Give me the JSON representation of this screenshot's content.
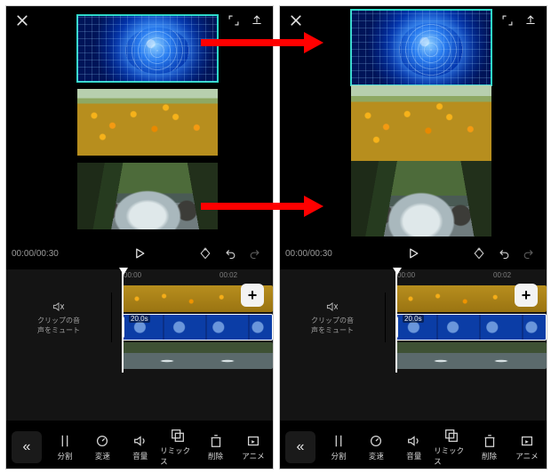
{
  "timecode": {
    "current": "00:00",
    "total": "00:30"
  },
  "ruler": {
    "t0": "00:00",
    "t1": "00:02"
  },
  "mute": {
    "line1": "クリップの音",
    "line2": "声をミュート"
  },
  "clip": {
    "selected_duration": "20.0s"
  },
  "add_label": "+",
  "toolbar": {
    "collapse": "«",
    "items": [
      {
        "id": "split",
        "label": "分割"
      },
      {
        "id": "speed",
        "label": "変速"
      },
      {
        "id": "volume",
        "label": "音量"
      },
      {
        "id": "remix",
        "label": "リミックス"
      },
      {
        "id": "delete",
        "label": "削除"
      },
      {
        "id": "anim",
        "label": "アニメ"
      }
    ]
  },
  "media": {
    "clips": [
      {
        "id": "globe",
        "desc": "blue digital globe"
      },
      {
        "id": "flowers",
        "desc": "orange flower field"
      },
      {
        "id": "creek",
        "desc": "forest creek"
      }
    ]
  },
  "layout": {
    "panelA": {
      "mediaTop": 10,
      "thumbH": 75,
      "gap": 8,
      "selected": true
    },
    "panelB": {
      "mediaTop": 4,
      "thumbH": 85,
      "gap": 0,
      "selected": true
    }
  }
}
